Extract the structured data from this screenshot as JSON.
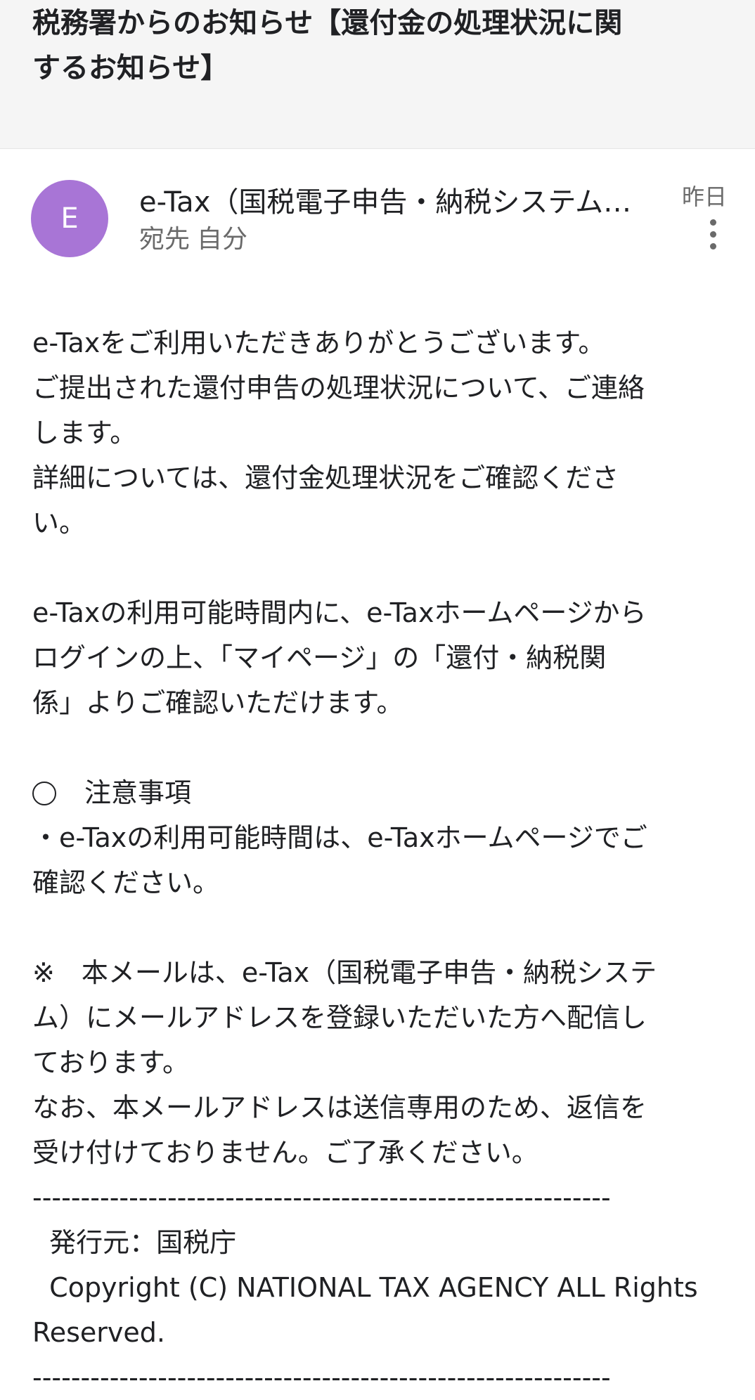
{
  "subject": {
    "lines": [
      "税務署からのお知らせ【還付金の処理状況に関",
      "するお知らせ】"
    ]
  },
  "sender": {
    "avatar_letter": "E",
    "avatar_color": "#a875d6",
    "name": "e-Tax（国税電子申告・納税システム…",
    "recipient_label": "宛先",
    "recipient_value": "自分",
    "date": "昨日"
  },
  "icons": {
    "more": "more-vert-icon",
    "notice_marker": "circle-icon"
  },
  "body": {
    "lines": [
      "e-Taxをご利用いただきありがとうございます。",
      "ご提出された還付申告の処理状況について、ご連絡",
      "します。",
      "詳細については、還付金処理状況をご確認くださ",
      "い。",
      "",
      "e-Taxの利用可能時間内に、e-Taxホームページから",
      "ログインの上、「マイページ」の「還付・納税関",
      "係」よりご確認いただけます。",
      "",
      "注意事項",
      "・e-Taxの利用可能時間は、e-Taxホームページでご",
      "確認ください。",
      "",
      "※　本メールは、e-Tax（国税電子申告・納税システ",
      "ム）にメールアドレスを登録いただいた方へ配信し",
      "ております。",
      "なお、本メールアドレスは送信専用のため、返信を",
      "受け付けておりません。ご了承ください。",
      "------------------------------------------------------------",
      "  発行元：国税庁",
      "  Copyright (C) NATIONAL TAX AGENCY ALL Rights",
      "Reserved.",
      "------------------------------------------------------------"
    ]
  }
}
